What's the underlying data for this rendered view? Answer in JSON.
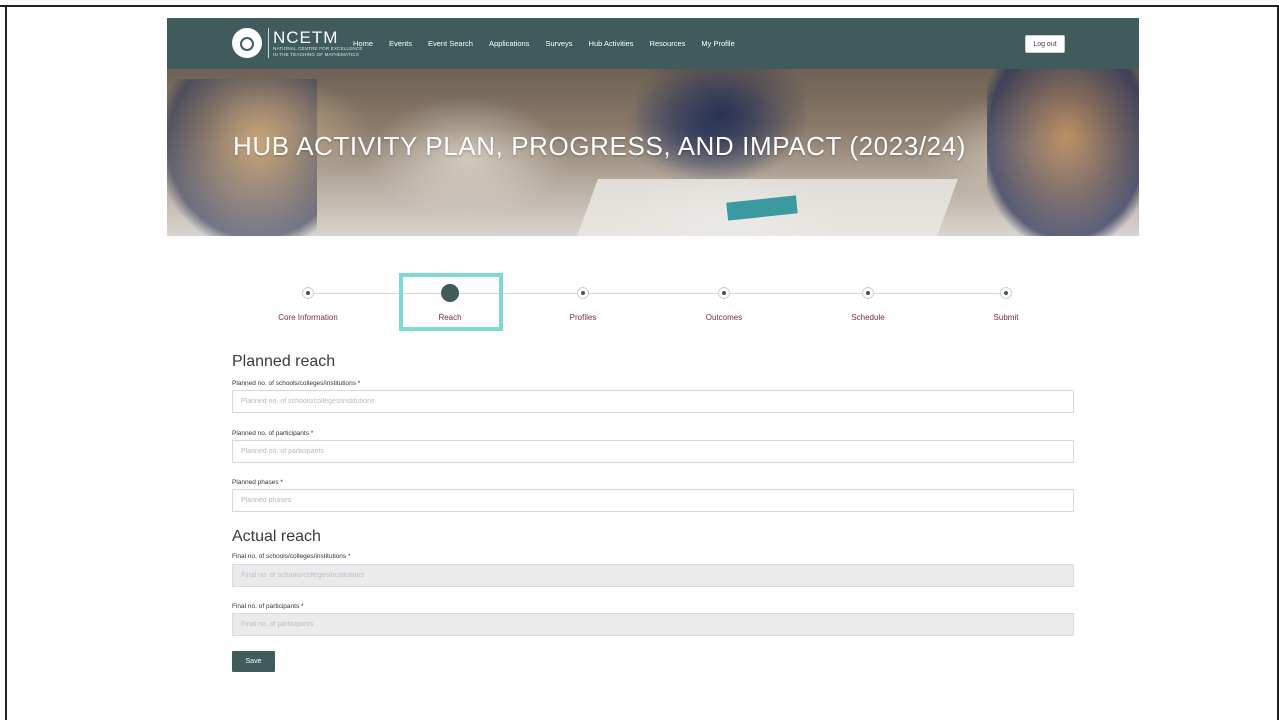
{
  "header": {
    "logo": {
      "title": "NCETM",
      "subtitle_line1": "NATIONAL CENTRE FOR EXCELLENCE",
      "subtitle_line2": "IN THE TEACHING OF MATHEMATICS"
    },
    "nav": [
      "Home",
      "Events",
      "Event Search",
      "Applications",
      "Surveys",
      "Hub Activities",
      "Resources",
      "My Profile"
    ],
    "logout_label": "Log out",
    "colors": {
      "header_bg": "#3f5b5b",
      "accent_highlight": "#7fd9d3",
      "step_label": "#7a2d3e"
    }
  },
  "hero": {
    "title": "HUB ACTIVITY PLAN, PROGRESS, AND IMPACT (2023/24)"
  },
  "stepper": {
    "steps": [
      "Core Information",
      "Reach",
      "Profiles",
      "Outcomes",
      "Schedule",
      "Submit"
    ],
    "active_step": "Reach"
  },
  "planned": {
    "title": "Planned reach",
    "schools": {
      "label": "Planned no. of schools/colleges/institutions *",
      "placeholder": "Planned no. of schools/colleges/institutions",
      "value": ""
    },
    "participants": {
      "label": "Planned no. of participants *",
      "placeholder": "Planned no. of participants",
      "value": ""
    },
    "phases": {
      "label": "Planned phases *",
      "placeholder": "Planned phases",
      "value": ""
    }
  },
  "actual": {
    "title": "Actual reach",
    "schools": {
      "label": "Final no. of schools/colleges/institutions *",
      "placeholder": "Final no. of schools/colleges/institutions",
      "value": ""
    },
    "participants": {
      "label": "Final no. of participants *",
      "placeholder": "Final no. of participants",
      "value": ""
    }
  },
  "save_label": "Save"
}
